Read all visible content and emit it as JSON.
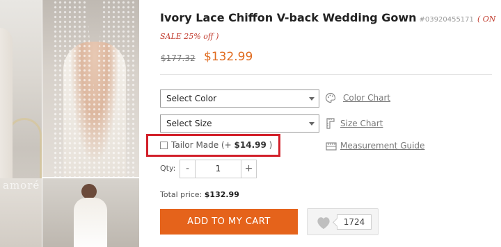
{
  "gallery": {
    "watermark": "amoré",
    "icons": [
      "product-photo-front",
      "product-photo-back",
      "product-thumb-1",
      "product-thumb-2"
    ]
  },
  "product": {
    "title": "Ivory Lace Chiffon V-back Wedding Gown",
    "sku": "#03920455171",
    "sale_text": "( ON SALE 25% off )",
    "old_price": "$177.32",
    "new_price": "$132.99",
    "accent_color": "#e5631b",
    "sale_color": "#c0392b"
  },
  "options": {
    "color_select": "Select Color",
    "size_select": "Select Size",
    "color_chart_link": "Color Chart",
    "size_chart_link": "Size Chart",
    "measurement_link": "Measurement Guide",
    "tailor_label": "Tailor Made (+ ",
    "tailor_price": "$14.99",
    "tailor_suffix": " )",
    "tailor_checked": false
  },
  "quantity": {
    "label": "Qty:",
    "minus": "-",
    "plus": "+",
    "value": "1"
  },
  "total": {
    "label": "Total price: ",
    "value": "$132.99"
  },
  "actions": {
    "add_to_cart": "ADD TO MY CART",
    "wishlist_count": "1724"
  }
}
